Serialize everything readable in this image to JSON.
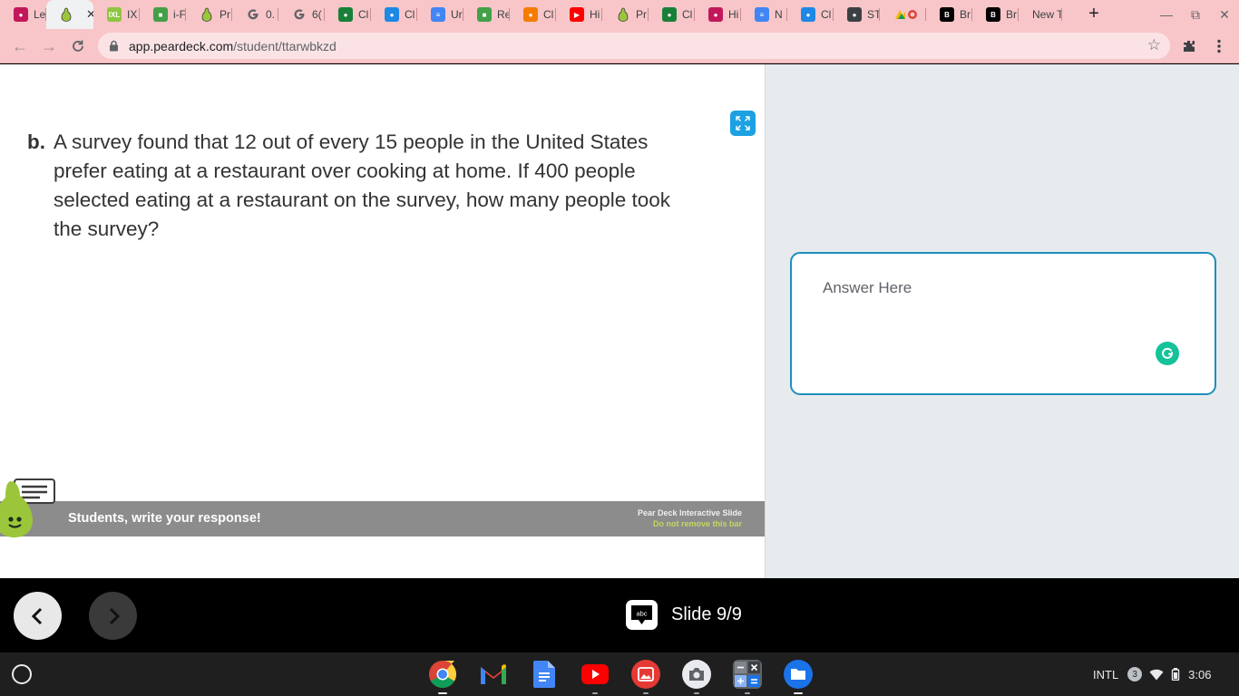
{
  "browser": {
    "tabs": [
      {
        "label": "Le",
        "icon": "pink-person-icon",
        "color": "#c2185b"
      },
      {
        "label": "",
        "icon": "pear-deck-icon",
        "active": true
      },
      {
        "label": "IX",
        "icon": "ixl-icon",
        "color": "#8dc63f"
      },
      {
        "label": "i-F",
        "icon": "green-cube-icon",
        "color": "#43a047"
      },
      {
        "label": "Pr",
        "icon": "pear-deck-icon"
      },
      {
        "label": "0.",
        "icon": "google-icon"
      },
      {
        "label": "6(",
        "icon": "google-icon"
      },
      {
        "label": "Cl",
        "icon": "classroom-icon",
        "color": "#188038"
      },
      {
        "label": "Cl",
        "icon": "classroom-icon",
        "color": "#1e88e5"
      },
      {
        "label": "Ur",
        "icon": "docs-icon",
        "color": "#4285f4"
      },
      {
        "label": "Re",
        "icon": "green-cube-icon",
        "color": "#43a047"
      },
      {
        "label": "Cl",
        "icon": "classroom-icon",
        "color": "#f57c00"
      },
      {
        "label": "Hi",
        "icon": "youtube-icon",
        "color": "#ff0000"
      },
      {
        "label": "Pr",
        "icon": "pear-deck-icon"
      },
      {
        "label": "Cl",
        "icon": "classroom-icon",
        "color": "#188038"
      },
      {
        "label": "Hi",
        "icon": "pink-person-icon",
        "color": "#c2185b"
      },
      {
        "label": "N",
        "icon": "docs-icon",
        "color": "#4285f4"
      },
      {
        "label": "Cl",
        "icon": "classroom-icon",
        "color": "#1e88e5"
      },
      {
        "label": "ST",
        "icon": "dark-person-icon",
        "color": "#3c4043"
      },
      {
        "label": "",
        "icon": "multicolor-icon"
      },
      {
        "label": "Br",
        "icon": "b-icon",
        "color": "#000000"
      },
      {
        "label": "Br",
        "icon": "b-icon",
        "color": "#000000"
      },
      {
        "label": "New T",
        "icon": "none"
      }
    ],
    "url_host": "app.peardeck.com",
    "url_path": "/student/ttarwbkzd"
  },
  "slide": {
    "question_letter": "b.",
    "question_text": "A survey found that 12 out of every 15 people in the United States prefer eating at a restaurant over cooking at home. If 400 people selected eating at a restaurant on the survey, how many people took the survey?",
    "bar_prompt": "Students, write your response!",
    "bar_brand": "Pear Deck Interactive Slide",
    "bar_warning": "Do not remove this bar"
  },
  "response": {
    "placeholder": "Answer Here"
  },
  "navigation": {
    "slide_label": "Slide 9/9",
    "slide_icon_text": "abc"
  },
  "shelf": {
    "apps": [
      "chrome-icon",
      "gmail-icon",
      "docs-icon",
      "youtube-icon",
      "gallery-icon",
      "camera-icon",
      "calculator-icon",
      "files-icon"
    ],
    "tray": {
      "input_method": "INTL",
      "notification_count": "3",
      "time": "3:06"
    }
  },
  "colors": {
    "browser_frame": "#f8c6c9",
    "accent_blue": "#1d8fbb",
    "expand_button": "#1da1e2",
    "bar_gray": "#8c8c8c",
    "warning_green": "#c6d65e",
    "grammarly_green": "#15c39a"
  }
}
